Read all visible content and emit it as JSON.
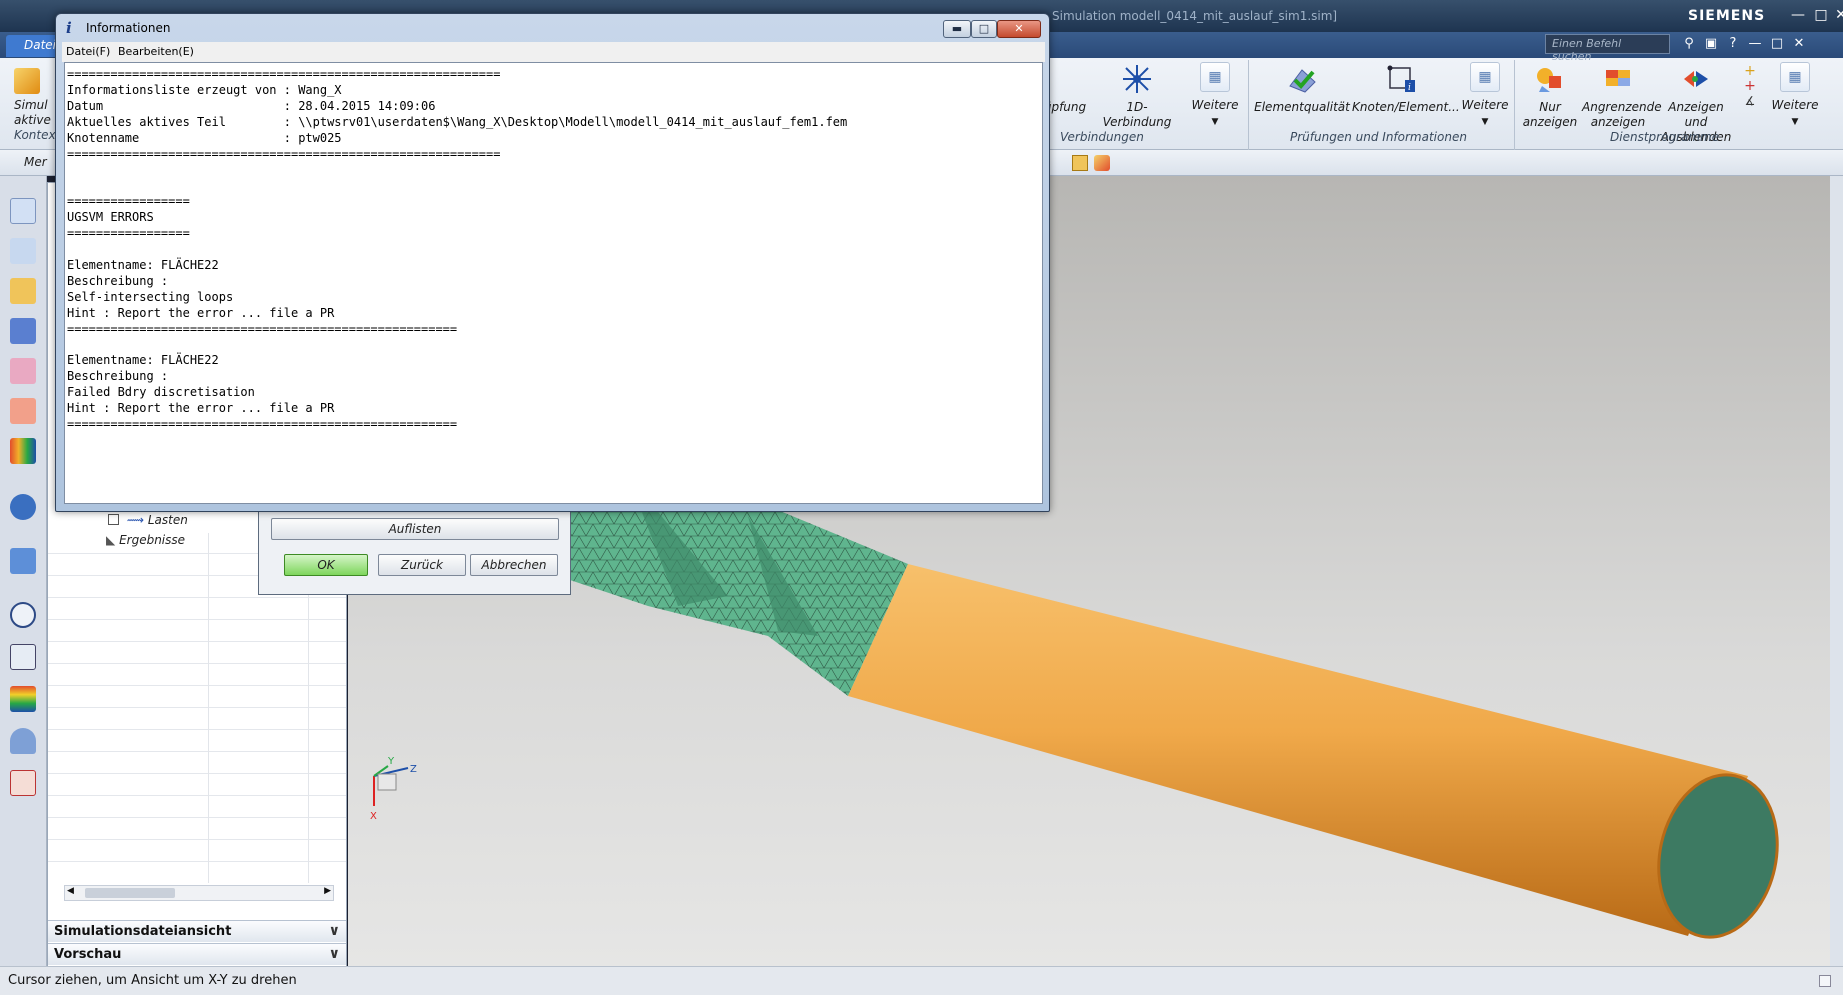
{
  "app": {
    "title": "Simulation modell_0414_mit_auslauf_sim1.sim]",
    "brand": "SIEMENS",
    "search_placeholder": "Einen Befehl suchen",
    "file_tab": "Datei",
    "left_truncated_labels": [
      "Simul",
      "aktive",
      "Kontex"
    ]
  },
  "ribbon": {
    "items": [
      {
        "label": "üpfung",
        "icon": "connection-icon"
      },
      {
        "label": "1D-Verbindung",
        "icon": "1d-connection-icon"
      },
      {
        "label": "Weitere",
        "icon": "more-grid-icon"
      },
      {
        "label": "Elementqualität",
        "icon": "element-quality-icon"
      },
      {
        "label": "Knoten/Element...",
        "icon": "node-element-icon"
      },
      {
        "label": "Weitere",
        "icon": "more-grid-icon"
      },
      {
        "label": "Nur anzeigen",
        "icon": "show-only-icon"
      },
      {
        "label": "Angrenzende anzeigen",
        "icon": "show-adjacent-icon"
      },
      {
        "label": "Anzeigen und Ausblenden",
        "icon": "show-hide-icon"
      },
      {
        "label": "Weitere",
        "icon": "more-grid-icon"
      }
    ],
    "groups": [
      "Verbindungen",
      "Prüfungen und Informationen",
      "Dienstprogramme"
    ]
  },
  "toolbar2": {
    "menu": "Mer"
  },
  "info_window": {
    "title": "Informationen",
    "menu": [
      "Datei(F)",
      "Bearbeiten(E)"
    ],
    "lines": [
      "============================================================",
      "Informationsliste erzeugt von : Wang_X",
      "Datum                         : 28.04.2015 14:09:06",
      "Aktuelles aktives Teil        : \\\\ptwsrv01\\userdaten$\\Wang_X\\Desktop\\Modell\\modell_0414_mit_auslauf_fem1.fem",
      "Knotenname                    : ptw025",
      "============================================================",
      "",
      "",
      "=================",
      "UGSVM ERRORS",
      "=================",
      "",
      "Elementname: FLÄCHE22",
      "Beschreibung :",
      "Self-intersecting loops",
      "Hint : Report the error ... file a PR",
      "======================================================",
      "",
      "Elementname: FLÄCHE22",
      "Beschreibung :",
      "Failed Bdry discretisation",
      "Hint : Report the error ... file a PR",
      "======================================================"
    ]
  },
  "list_dialog": {
    "list_button": "Auflisten",
    "ok": "OK",
    "back": "Zurück",
    "cancel": "Abbrechen"
  },
  "navigator": {
    "tree_lasten": "Lasten",
    "tree_ergebnisse": "Ergebnisse",
    "section_sim_view": "Simulationsdateiansicht",
    "section_preview": "Vorschau"
  },
  "triad": {
    "y": "Y",
    "z": "Z",
    "x": "X"
  },
  "status": {
    "text": "Cursor ziehen, um Ansicht um X-Y zu drehen"
  },
  "colors": {
    "mesh": "#5fb58e",
    "cylinder": "#f0a94a",
    "ok_button": "#7ed65c",
    "close_button": "#c44a2e"
  }
}
